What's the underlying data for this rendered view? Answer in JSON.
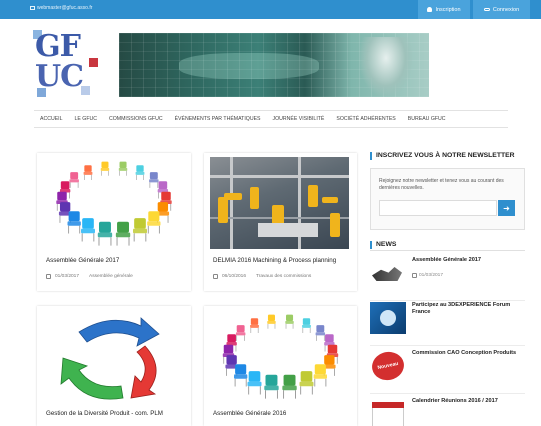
{
  "topbar": {
    "email": "webmaster@gfuc.asso.fr",
    "signup_label": "Inscription",
    "login_label": "Connexion",
    "accent": "#2f8fce"
  },
  "logo": {
    "line1": "GF",
    "line2": "UC"
  },
  "nav": {
    "items": [
      "ACCUEIL",
      "LE GFUC",
      "COMMISSIONS GFUC",
      "ÉVÉNEMENTS PAR THÉMATIQUES",
      "JOURNÉE VISIBILITÉ",
      "SOCIÉTÉ ADHÉRENTES",
      "BUREAU GFUC"
    ]
  },
  "cards": [
    {
      "title": "Assemblée Générale 2017",
      "date": "01/03/2017",
      "category": "Assemblée générale"
    },
    {
      "title": "DELMIA 2016 Machining & Process planning",
      "date": "06/10/2016",
      "category": "Travaux des commissions"
    },
    {
      "title": "Gestion de la Diversité Produit - com. PLM",
      "date": "",
      "category": ""
    },
    {
      "title": "Assemblée Générale 2016",
      "date": "",
      "category": ""
    }
  ],
  "newsletter": {
    "heading": "INSCRIVEZ VOUS À NOTRE NEWSLETTER",
    "text": "Rejoignez notre newsletter et tenez vous au courant des dernières nouvelles.",
    "placeholder": "",
    "submit_icon": "arrow-right-icon"
  },
  "news": {
    "heading": "NEWS",
    "items": [
      {
        "title": "Assemblée Générale 2017",
        "date": "01/03/2017"
      },
      {
        "title": "Participez au 3DEXPERIENCE Forum France",
        "date": ""
      },
      {
        "title": "Commission CAO Conception Produits",
        "date": "",
        "badge": "Nouveau"
      },
      {
        "title": "Calendrier Réunions 2016 / 2017",
        "date": ""
      }
    ]
  },
  "chair_colors": [
    "#e53935",
    "#fb8c00",
    "#fdd835",
    "#c0ca33",
    "#43a047",
    "#26a69a",
    "#29b6f6",
    "#1e88e5",
    "#5e35b1",
    "#8e24aa",
    "#d81b60",
    "#f06292",
    "#ff7043",
    "#ffca28",
    "#9ccc65",
    "#4dd0e1",
    "#7986cb",
    "#ba68c8"
  ]
}
